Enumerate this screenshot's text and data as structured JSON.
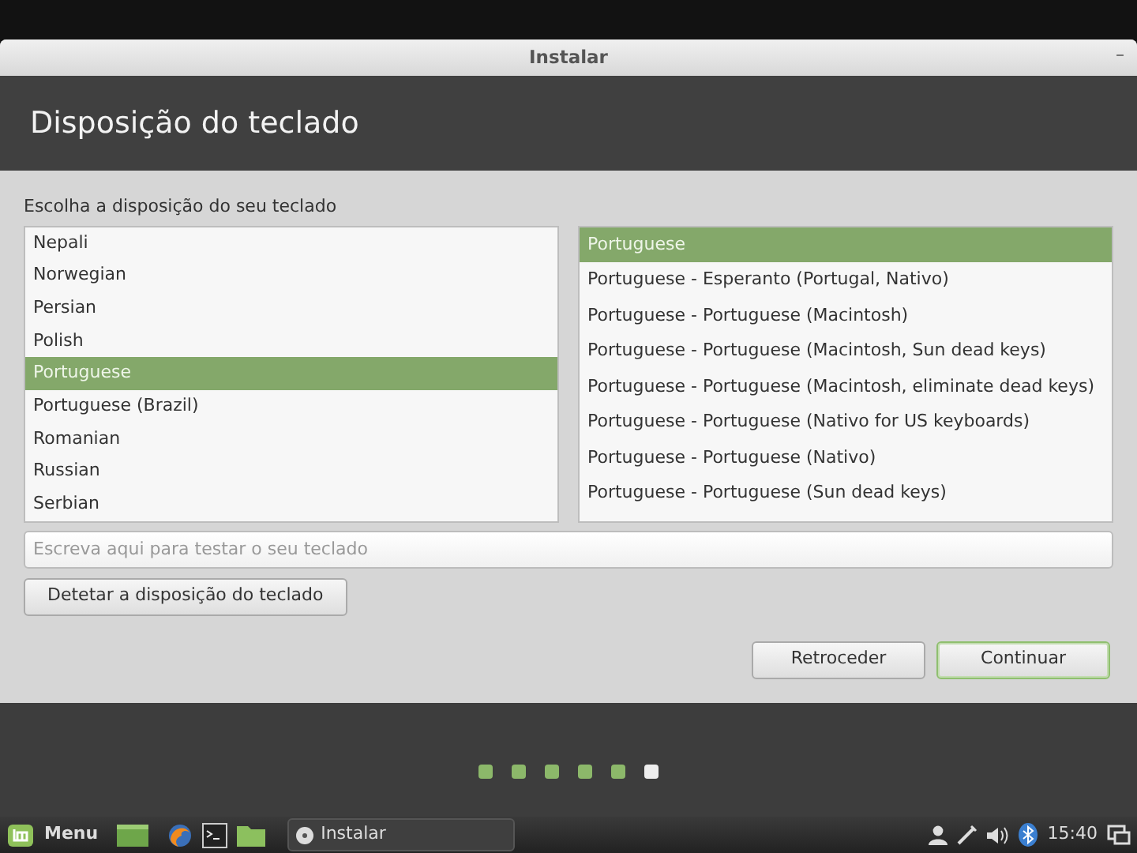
{
  "window": {
    "title": "Instalar",
    "minimize": "–"
  },
  "header": {
    "title": "Disposição do teclado"
  },
  "prompt": "Escolha a disposição do seu teclado",
  "layouts": [
    {
      "label": "Nepali",
      "selected": false
    },
    {
      "label": "Norwegian",
      "selected": false
    },
    {
      "label": "Persian",
      "selected": false
    },
    {
      "label": "Polish",
      "selected": false
    },
    {
      "label": "Portuguese",
      "selected": true
    },
    {
      "label": "Portuguese (Brazil)",
      "selected": false
    },
    {
      "label": "Romanian",
      "selected": false
    },
    {
      "label": "Russian",
      "selected": false
    },
    {
      "label": "Serbian",
      "selected": false
    }
  ],
  "variants": [
    {
      "label": "Portuguese",
      "selected": true
    },
    {
      "label": "Portuguese - Esperanto (Portugal, Nativo)",
      "selected": false
    },
    {
      "label": "Portuguese - Portuguese (Macintosh)",
      "selected": false
    },
    {
      "label": "Portuguese - Portuguese (Macintosh, Sun dead keys)",
      "selected": false
    },
    {
      "label": "Portuguese - Portuguese (Macintosh, eliminate dead keys)",
      "selected": false
    },
    {
      "label": "Portuguese - Portuguese (Nativo for US keyboards)",
      "selected": false
    },
    {
      "label": "Portuguese - Portuguese (Nativo)",
      "selected": false
    },
    {
      "label": "Portuguese - Portuguese (Sun dead keys)",
      "selected": false
    }
  ],
  "test_field": {
    "placeholder": "Escreva aqui para testar o seu teclado"
  },
  "detect_button": "Detetar a disposição do teclado",
  "buttons": [
    {
      "label": "Retroceder",
      "default": false
    },
    {
      "label": "Continuar",
      "default": true
    }
  ],
  "progress_steps": [
    {
      "done": true
    },
    {
      "done": true
    },
    {
      "done": true
    },
    {
      "done": true
    },
    {
      "done": true
    },
    {
      "done": false
    }
  ],
  "taskbar": {
    "menu_label": "Menu",
    "window_button": "Instalar",
    "clock": "15:40"
  }
}
